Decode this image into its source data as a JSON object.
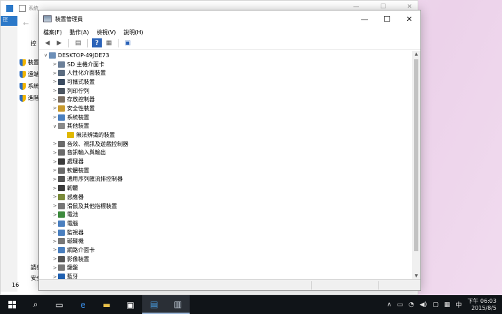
{
  "background_window": {
    "title": "系統",
    "left_nav_partial": "控",
    "tab_partial": "控",
    "side_items": [
      "裝置",
      "遠端",
      "系統",
      "進階"
    ],
    "bottom_left_1": "請參",
    "bottom_left_2": "安全",
    "bottom_num": "16"
  },
  "dm": {
    "title": "裝置管理員",
    "controls": {
      "minimize": "—",
      "maximize": "☐",
      "close": "✕"
    },
    "menu": [
      "檔案(F)",
      "動作(A)",
      "檢視(V)",
      "說明(H)"
    ],
    "toolbar": {
      "back": "◀",
      "forward": "▶",
      "view1": "▤",
      "help": "?",
      "view2": "▦",
      "scan": "▣"
    },
    "tree": [
      {
        "label": "DESKTOP-49JDE73",
        "level": 0,
        "exp": "∨",
        "icon": "computer-icon",
        "color": "#6c8fb8"
      },
      {
        "label": "SD 主機介面卡",
        "level": 1,
        "exp": ">",
        "icon": "sd-host-icon",
        "color": "#6b7f98"
      },
      {
        "label": "人性化介面裝置",
        "level": 1,
        "exp": ">",
        "icon": "hid-icon",
        "color": "#5b6c80"
      },
      {
        "label": "可攜式裝置",
        "level": 1,
        "exp": ">",
        "icon": "portable-device-icon",
        "color": "#3a4b60"
      },
      {
        "label": "列印佇列",
        "level": 1,
        "exp": ">",
        "icon": "printer-icon",
        "color": "#4c5560"
      },
      {
        "label": "存放控制器",
        "level": 1,
        "exp": ">",
        "icon": "storage-controller-icon",
        "color": "#7b6f63"
      },
      {
        "label": "安全性裝置",
        "level": 1,
        "exp": ">",
        "icon": "security-device-icon",
        "color": "#c99a2e"
      },
      {
        "label": "系統裝置",
        "level": 1,
        "exp": ">",
        "icon": "system-device-icon",
        "color": "#4a7fbf"
      },
      {
        "label": "其他裝置",
        "level": 1,
        "exp": "∨",
        "icon": "other-devices-icon",
        "color": "#8a8a8a"
      },
      {
        "label": "無法辨識的裝置",
        "level": 2,
        "exp": "",
        "icon": "unknown-device-warning-icon",
        "color": "#e0b800"
      },
      {
        "label": "音效、視訊及遊戲控制器",
        "level": 1,
        "exp": ">",
        "icon": "sound-video-icon",
        "color": "#6b6b6b"
      },
      {
        "label": "音訊輸入與輸出",
        "level": 1,
        "exp": ">",
        "icon": "audio-io-icon",
        "color": "#6b6b6b"
      },
      {
        "label": "處理器",
        "level": 1,
        "exp": ">",
        "icon": "processor-icon",
        "color": "#3b3b3b"
      },
      {
        "label": "軟體裝置",
        "level": 1,
        "exp": ">",
        "icon": "software-device-icon",
        "color": "#6b6b6b"
      },
      {
        "label": "通用序列匯流排控制器",
        "level": 1,
        "exp": ">",
        "icon": "usb-controller-icon",
        "color": "#555"
      },
      {
        "label": "韌體",
        "level": 1,
        "exp": ">",
        "icon": "firmware-icon",
        "color": "#3b3b3b"
      },
      {
        "label": "感應器",
        "level": 1,
        "exp": ">",
        "icon": "sensor-icon",
        "color": "#7a8a3a"
      },
      {
        "label": "滑鼠及其他指標裝置",
        "level": 1,
        "exp": ">",
        "icon": "mouse-icon",
        "color": "#777"
      },
      {
        "label": "電池",
        "level": 1,
        "exp": ">",
        "icon": "battery-icon",
        "color": "#3d8a3d"
      },
      {
        "label": "電腦",
        "level": 1,
        "exp": ">",
        "icon": "computer-small-icon",
        "color": "#4a7fbf"
      },
      {
        "label": "監視器",
        "level": 1,
        "exp": ">",
        "icon": "monitor-icon",
        "color": "#4a7fbf"
      },
      {
        "label": "磁碟機",
        "level": 1,
        "exp": ">",
        "icon": "disk-drive-icon",
        "color": "#777"
      },
      {
        "label": "網路介面卡",
        "level": 1,
        "exp": ">",
        "icon": "network-adapter-icon",
        "color": "#4a7fbf"
      },
      {
        "label": "影像裝置",
        "level": 1,
        "exp": ">",
        "icon": "imaging-device-icon",
        "color": "#555"
      },
      {
        "label": "鍵盤",
        "level": 1,
        "exp": ">",
        "icon": "keyboard-icon",
        "color": "#777"
      },
      {
        "label": "藍牙",
        "level": 1,
        "exp": ">",
        "icon": "bluetooth-icon",
        "color": "#2060b0"
      }
    ]
  },
  "taskbar": {
    "start": "start-icon",
    "search": "⌕",
    "taskview": "▭",
    "apps": [
      {
        "name": "edge-icon",
        "glyph": "e",
        "color": "#3a8ee6"
      },
      {
        "name": "file-explorer-icon",
        "glyph": "▬",
        "color": "#e8c04a"
      },
      {
        "name": "store-icon",
        "glyph": "▣",
        "color": "#ffffff"
      },
      {
        "name": "system-app-icon",
        "glyph": "▤",
        "color": "#4aa0e6"
      },
      {
        "name": "device-manager-app-icon",
        "glyph": "▥",
        "color": "#c9d4e0"
      }
    ],
    "tray": {
      "chevron": "∧",
      "battery": "▭",
      "network": "◔",
      "volume": "◀)",
      "notifications": "▢",
      "keyboard": "▦",
      "ime": "中",
      "time": "下午 06:03",
      "date": "2015/8/5"
    }
  }
}
